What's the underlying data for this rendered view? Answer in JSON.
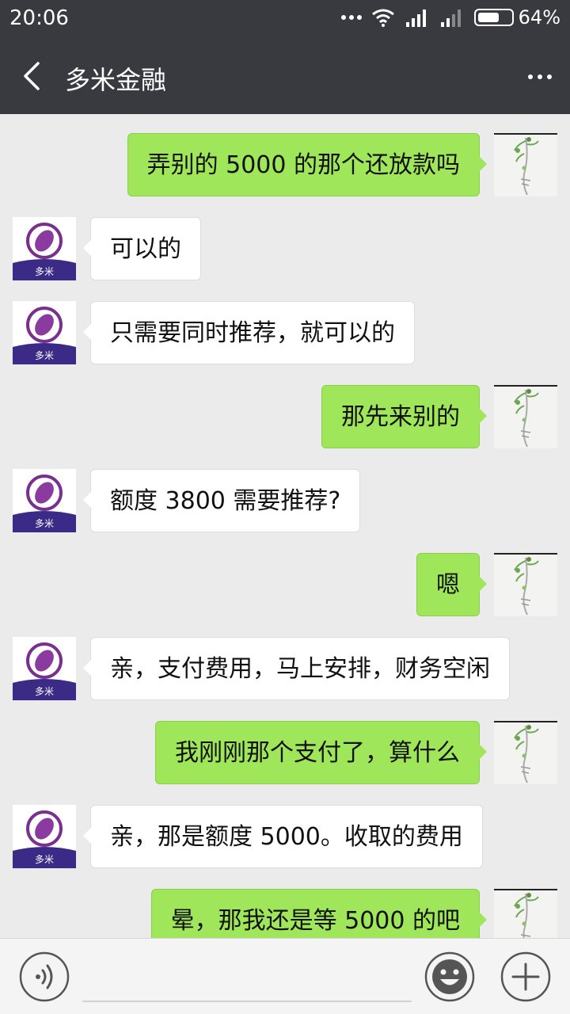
{
  "status_bar": {
    "time": "20:06",
    "battery": "64%",
    "battery_level": 0.64
  },
  "header": {
    "title": "多米金融"
  },
  "contact_avatar_text": "多米",
  "messages": [
    {
      "side": "out",
      "text": "弄别的 5000 的那个还放款吗"
    },
    {
      "side": "in",
      "text": "可以的"
    },
    {
      "side": "in",
      "text": "只需要同时推荐，就可以的"
    },
    {
      "side": "out",
      "text": "那先来别的"
    },
    {
      "side": "in",
      "text": "额度 3800 需要推荐?"
    },
    {
      "side": "out",
      "text": "嗯"
    },
    {
      "side": "in",
      "text": "亲，支付费用，马上安排，财务空闲"
    },
    {
      "side": "out",
      "text": "我刚刚那个支付了，算什么"
    },
    {
      "side": "in",
      "text": "亲，那是额度 5000。收取的费用"
    },
    {
      "side": "out",
      "text": "晕，那我还是等 5000 的吧"
    }
  ],
  "icons": {
    "back": "back-arrow-icon",
    "more": "more-icon",
    "voice": "voice-icon",
    "emoji": "emoji-icon",
    "plus": "plus-icon"
  },
  "colors": {
    "bar": "#393a3f",
    "background": "#ebebeb",
    "outgoing_bubble": "#9fe65a",
    "incoming_bubble": "#ffffff"
  }
}
